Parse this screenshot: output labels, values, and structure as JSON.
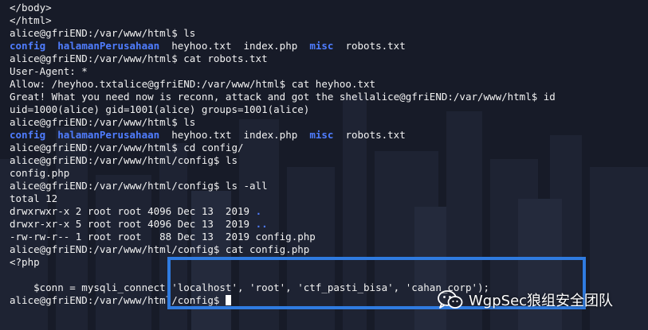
{
  "colors": {
    "background": "#171b28",
    "text": "#f2f2f2",
    "directory": "#4f7dff",
    "highlight_box": "#2f7be0"
  },
  "terminal": {
    "lines": [
      {
        "segments": [
          {
            "t": "</body>"
          }
        ]
      },
      {
        "segments": [
          {
            "t": "</html>"
          }
        ]
      },
      {
        "segments": [
          {
            "t": "alice@gfriEND:/var/www/html$ ls"
          }
        ]
      },
      {
        "segments": [
          {
            "t": "config",
            "c": "blue"
          },
          {
            "t": "  "
          },
          {
            "t": "halamanPerusahaan",
            "c": "blue"
          },
          {
            "t": "  heyhoo.txt  index.php  "
          },
          {
            "t": "misc",
            "c": "blue"
          },
          {
            "t": "  robots.txt"
          }
        ]
      },
      {
        "segments": [
          {
            "t": "alice@gfriEND:/var/www/html$ cat robots.txt"
          }
        ]
      },
      {
        "segments": [
          {
            "t": "User-Agent: *"
          }
        ]
      },
      {
        "segments": [
          {
            "t": "Allow: /heyhoo.txtalice@gfriEND:/var/www/html$ cat heyhoo.txt"
          }
        ]
      },
      {
        "segments": [
          {
            "t": "Great! What you need now is reconn, attack and got the shellalice@gfriEND:/var/www/html$ id"
          }
        ]
      },
      {
        "segments": [
          {
            "t": "uid=1000(alice) gid=1001(alice) groups=1001(alice)"
          }
        ]
      },
      {
        "segments": [
          {
            "t": "alice@gfriEND:/var/www/html$ ls"
          }
        ]
      },
      {
        "segments": [
          {
            "t": "config",
            "c": "blue"
          },
          {
            "t": "  "
          },
          {
            "t": "halamanPerusahaan",
            "c": "blue"
          },
          {
            "t": "  heyhoo.txt  index.php  "
          },
          {
            "t": "misc",
            "c": "blue"
          },
          {
            "t": "  robots.txt"
          }
        ]
      },
      {
        "segments": [
          {
            "t": "alice@gfriEND:/var/www/html$ cd config/"
          }
        ]
      },
      {
        "segments": [
          {
            "t": "alice@gfriEND:/var/www/html/config$ ls"
          }
        ]
      },
      {
        "segments": [
          {
            "t": "config.php"
          }
        ]
      },
      {
        "segments": [
          {
            "t": "alice@gfriEND:/var/www/html/config$ ls -all"
          }
        ]
      },
      {
        "segments": [
          {
            "t": "total 12"
          }
        ]
      },
      {
        "segments": [
          {
            "t": "drwxrwxr-x 2 root root 4096 Dec 13  2019 "
          },
          {
            "t": ".",
            "c": "blue"
          }
        ]
      },
      {
        "segments": [
          {
            "t": "drwxr-xr-x 5 root root 4096 Dec 13  2019 "
          },
          {
            "t": "..",
            "c": "blue"
          }
        ]
      },
      {
        "segments": [
          {
            "t": "-rw-rw-r-- 1 root root   88 Dec 13  2019 config.php"
          }
        ]
      },
      {
        "segments": [
          {
            "t": "alice@gfriEND:/var/www/html/config$ cat config.php"
          }
        ]
      },
      {
        "segments": [
          {
            "t": "<?php"
          }
        ]
      },
      {
        "segments": [
          {
            "t": ""
          }
        ]
      },
      {
        "segments": [
          {
            "t": "    $conn = mysqli_connect('localhost', 'root', 'ctf_pasti_bisa', 'cahan_corp');"
          }
        ]
      },
      {
        "segments": [
          {
            "t": "alice@gfriEND:/var/www/html/config$ "
          }
        ],
        "cursor": true
      }
    ]
  },
  "watermark": {
    "text": "WgpSec狼组安全团队",
    "icon": "wechat-icon"
  }
}
